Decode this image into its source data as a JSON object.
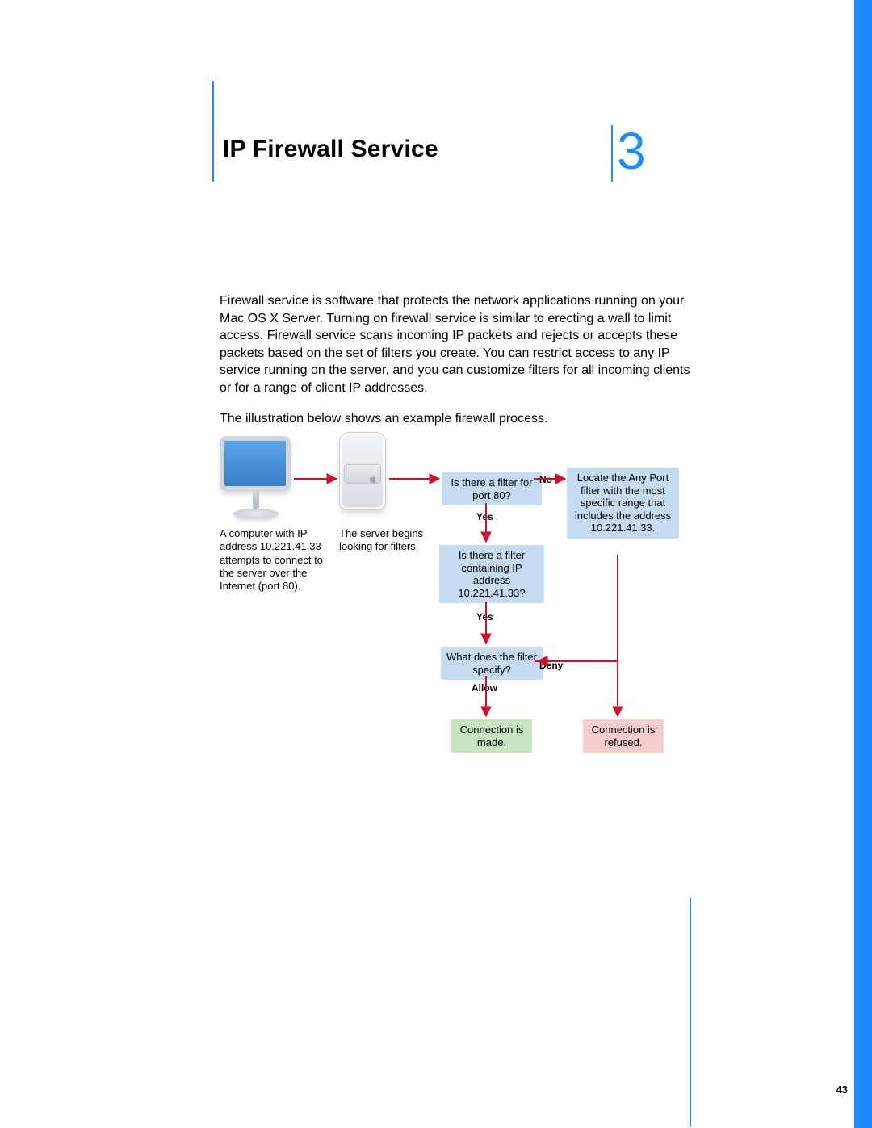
{
  "chapter": {
    "title": "IP Firewall Service",
    "number": "3"
  },
  "page_number": "43",
  "paragraphs": {
    "p1": "Firewall service is software that protects the network applications running on your Mac OS X Server. Turning on firewall service is similar to erecting a wall to limit access. Firewall service scans incoming IP packets and rejects or accepts these packets based on the set of filters you create. You can restrict access to any IP service running on the server, and you can customize filters for all incoming clients or for a range of client IP addresses.",
    "p2": "The illustration below shows an example firewall process."
  },
  "diagram": {
    "client_caption": "A computer with IP address 10.221.41.33 attempts to connect to the server over the Internet (port 80).",
    "server_caption": "The server begins looking for filters.",
    "q_port80": "Is there a filter for port 80?",
    "q_ip": "Is there a filter containing IP address 10.221.41.33?",
    "q_spec": "What does the filter specify?",
    "locate": "Locate the Any Port filter with the most specific range that includes the address 10.221.41.33.",
    "conn_made": "Connection is made.",
    "conn_refused": "Connection is refused.",
    "yes": "Yes",
    "no": "No",
    "allow": "Allow",
    "deny": "Deny"
  }
}
